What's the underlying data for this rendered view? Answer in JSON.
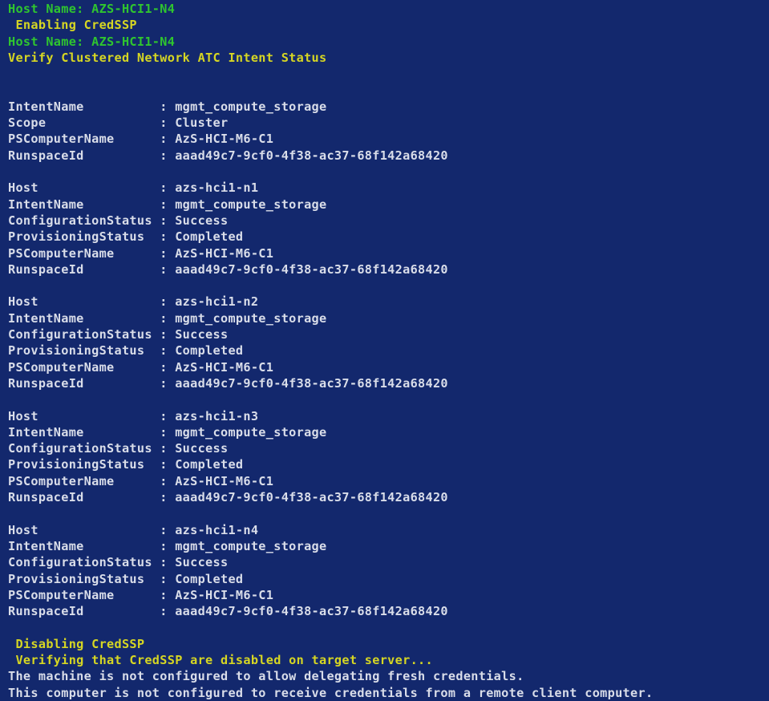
{
  "console": {
    "background_color": "#13286d",
    "colors": {
      "green": "#2fc52f",
      "yellow": "#d6d623",
      "white": "#d9dde9"
    },
    "header_lines": [
      {
        "text": "Host Name: AZS-HCI1-N4",
        "color": "green"
      },
      {
        "text": " Enabling CredSSP",
        "color": "yellow"
      },
      {
        "text": "Host Name: AZS-HCI1-N4",
        "color": "green"
      },
      {
        "text": "Verify Clustered Network ATC Intent Status",
        "color": "yellow"
      }
    ],
    "cluster_block": {
      "label_width": 20,
      "rows": [
        {
          "label": "IntentName",
          "value": "mgmt_compute_storage"
        },
        {
          "label": "Scope",
          "value": "Cluster"
        },
        {
          "label": "PSComputerName",
          "value": "AzS-HCI-M6-C1"
        },
        {
          "label": "RunspaceId",
          "value": "aaad49c7-9cf0-4f38-ac37-68f142a68420"
        }
      ]
    },
    "host_blocks": [
      {
        "rows": [
          {
            "label": "Host",
            "value": "azs-hci1-n1"
          },
          {
            "label": "IntentName",
            "value": "mgmt_compute_storage"
          },
          {
            "label": "ConfigurationStatus",
            "value": "Success"
          },
          {
            "label": "ProvisioningStatus",
            "value": "Completed"
          },
          {
            "label": "PSComputerName",
            "value": "AzS-HCI-M6-C1"
          },
          {
            "label": "RunspaceId",
            "value": "aaad49c7-9cf0-4f38-ac37-68f142a68420"
          }
        ]
      },
      {
        "rows": [
          {
            "label": "Host",
            "value": "azs-hci1-n2"
          },
          {
            "label": "IntentName",
            "value": "mgmt_compute_storage"
          },
          {
            "label": "ConfigurationStatus",
            "value": "Success"
          },
          {
            "label": "ProvisioningStatus",
            "value": "Completed"
          },
          {
            "label": "PSComputerName",
            "value": "AzS-HCI-M6-C1"
          },
          {
            "label": "RunspaceId",
            "value": "aaad49c7-9cf0-4f38-ac37-68f142a68420"
          }
        ]
      },
      {
        "rows": [
          {
            "label": "Host",
            "value": "azs-hci1-n3"
          },
          {
            "label": "IntentName",
            "value": "mgmt_compute_storage"
          },
          {
            "label": "ConfigurationStatus",
            "value": "Success"
          },
          {
            "label": "ProvisioningStatus",
            "value": "Completed"
          },
          {
            "label": "PSComputerName",
            "value": "AzS-HCI-M6-C1"
          },
          {
            "label": "RunspaceId",
            "value": "aaad49c7-9cf0-4f38-ac37-68f142a68420"
          }
        ]
      },
      {
        "rows": [
          {
            "label": "Host",
            "value": "azs-hci1-n4"
          },
          {
            "label": "IntentName",
            "value": "mgmt_compute_storage"
          },
          {
            "label": "ConfigurationStatus",
            "value": "Success"
          },
          {
            "label": "ProvisioningStatus",
            "value": "Completed"
          },
          {
            "label": "PSComputerName",
            "value": "AzS-HCI-M6-C1"
          },
          {
            "label": "RunspaceId",
            "value": "aaad49c7-9cf0-4f38-ac37-68f142a68420"
          }
        ]
      }
    ],
    "footer_lines": [
      {
        "text": " Disabling CredSSP",
        "color": "yellow"
      },
      {
        "text": " Verifying that CredSSP are disabled on target server...",
        "color": "yellow"
      },
      {
        "text": "The machine is not configured to allow delegating fresh credentials.",
        "color": "white"
      },
      {
        "text": "This computer is not configured to receive credentials from a remote client computer.",
        "color": "white"
      }
    ]
  }
}
